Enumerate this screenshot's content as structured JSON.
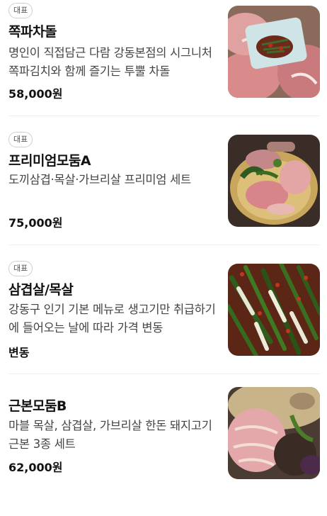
{
  "menu": {
    "items": [
      {
        "badge": "대표",
        "name": "쪽파차돌",
        "description": "명인이 직접담근 다람 강동본점의 시그니처 쪽파김치와 함께 즐기는 투뿔 차돌",
        "price": "58,000원",
        "image_icon": "dish-photo-chadol"
      },
      {
        "badge": "대표",
        "name": "프리미엄모둠A",
        "description": "도끼삼겹·목살·가브리살 프리미엄 세트",
        "price": "75,000원",
        "image_icon": "dish-photo-premium-platter"
      },
      {
        "badge": "대표",
        "name": "삼겹살/목살",
        "description": "강동구 인기 기본 메뉴로 생고기만 취급하기에 들어오는 날에 따라 가격 변동",
        "price": "변동",
        "image_icon": "dish-photo-green-onion-kimchi"
      },
      {
        "badge": "",
        "name": "근본모둠B",
        "description": "마블 목살, 삼겹살, 가브리살 한돈 돼지고기 근본 3종 세트",
        "price": "62,000원",
        "image_icon": "dish-photo-pork-platter"
      }
    ]
  }
}
